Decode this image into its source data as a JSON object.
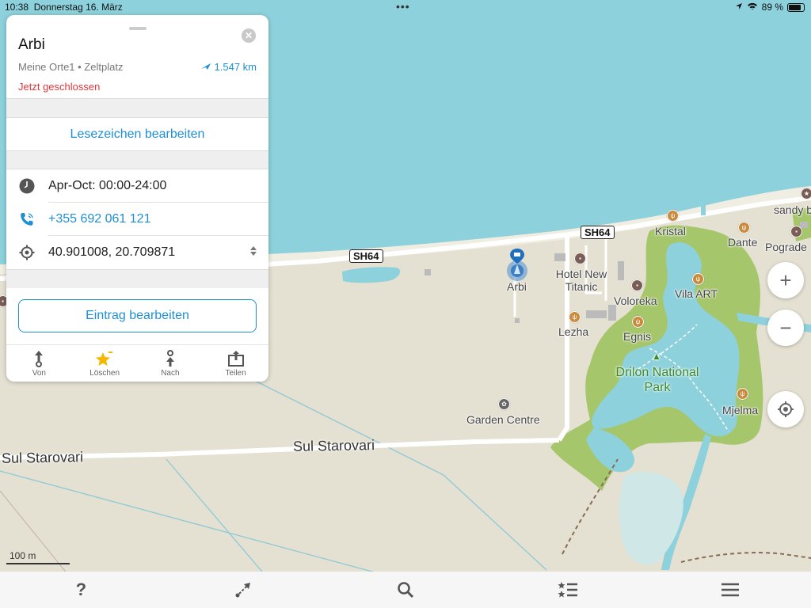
{
  "status_bar": {
    "time": "10:38",
    "date": "Donnerstag 16. März",
    "battery": "89 %"
  },
  "place_card": {
    "title": "Arbi",
    "subtitle": "Meine Orte1 • Zeltplatz",
    "distance": "1.547 km",
    "status": "Jetzt geschlossen",
    "edit_bookmark": "Lesezeichen bearbeiten",
    "opening_hours": "Apr-Oct: 00:00-24:00",
    "phone": "+355 692 061 121",
    "coordinates": "40.901008, 20.709871",
    "edit_entry": "Eintrag bearbeiten",
    "actions": [
      {
        "label": "Von",
        "icon": "route-from-icon"
      },
      {
        "label": "Löschen",
        "icon": "bookmark-star-icon"
      },
      {
        "label": "Nach",
        "icon": "route-to-icon"
      },
      {
        "label": "Teilen",
        "icon": "share-icon"
      }
    ]
  },
  "map": {
    "labels": {
      "sh64_a": "SH64",
      "sh64_b": "SH64",
      "road_left": "Sul Starovari",
      "road_right": "Sul Starovari",
      "arbi": "Arbi",
      "hotel": "Hotel New Titanic",
      "voloreka": "Voloreka",
      "vila_art": "Vila ART",
      "lezha": "Lezha",
      "egnis": "Egnis",
      "kristal": "Kristal",
      "dante": "Dante",
      "sandy": "sandy b",
      "pogradec": "Pograde",
      "park": "Drilon National Park",
      "mjelma": "Mjelma",
      "garden": "Garden Centre"
    },
    "scale": "100 m",
    "colors": {
      "water": "#8dd1dc",
      "land": "#e4e0d2",
      "park": "#a6c66c",
      "road": "#ffffff",
      "accent": "#1e8fd6"
    }
  },
  "controls": {
    "zoom_in": "+",
    "zoom_out": "−"
  },
  "toolbar": [
    {
      "name": "help-icon"
    },
    {
      "name": "route-icon"
    },
    {
      "name": "search-icon"
    },
    {
      "name": "bookmarks-icon"
    },
    {
      "name": "menu-icon"
    }
  ]
}
